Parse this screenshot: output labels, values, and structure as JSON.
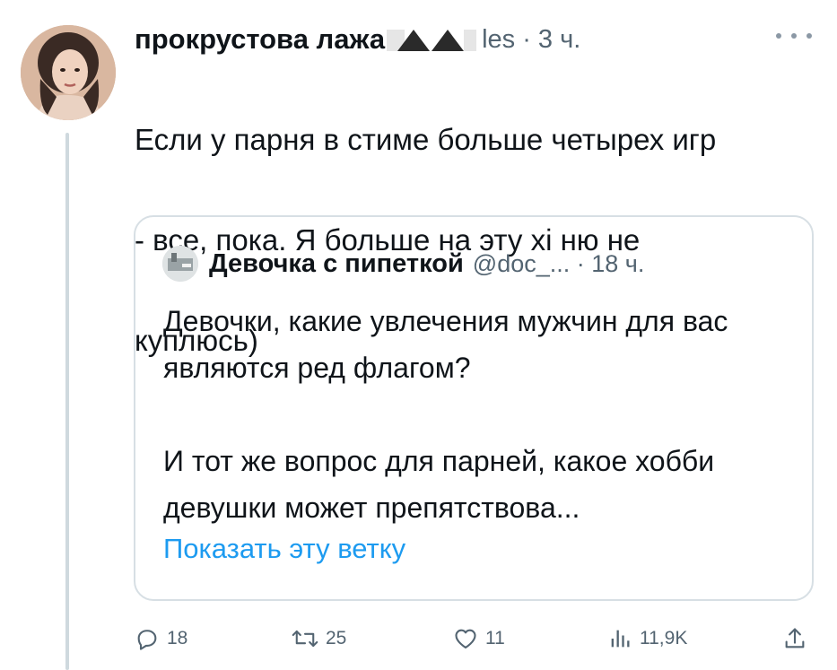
{
  "tweet": {
    "author_name": "прокрустова лажа",
    "handle_time": "les · 3 ч.",
    "text_lines": [
      "Если у парня в стиме больше четырех игр",
      "- все, пока. Я больше на эту хі ню не",
      "куплюсь)"
    ]
  },
  "quote": {
    "author_name": "Девочка с пипеткой",
    "handle_time": "@doc_... · 18 ч.",
    "paragraph1": "Девочки, какие увлечения мужчин для вас являются ред флагом?",
    "paragraph2": "И тот же вопрос для парней, какое хобби девушки может препятствова...",
    "show_thread": "Показать эту ветку"
  },
  "actions": {
    "replies": "18",
    "retweets": "25",
    "likes": "11",
    "views": "11,9K"
  },
  "icons": [
    "more-icon",
    "reply-icon",
    "retweet-icon",
    "like-icon",
    "views-icon",
    "share-icon"
  ],
  "colors": {
    "text": "#0f1419",
    "secondary": "#536471",
    "link": "#1d9bf0",
    "border": "#d7dfe4"
  }
}
